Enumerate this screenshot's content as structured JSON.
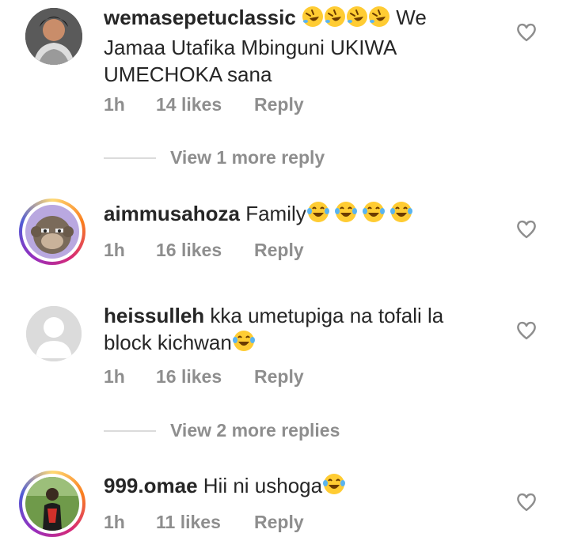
{
  "comments": [
    {
      "username": "wemasepetuclassic",
      "text_after_emoji": " We Jamaa Utafika Mbinguni UKIWA UMECHOKA sana",
      "emoji_desc": "rolling-on-floor-laughing",
      "time": "1h",
      "likes": "14 likes",
      "reply": "Reply"
    },
    {
      "username": "aimmusahoza",
      "text": "Family",
      "emoji_desc": "tears-of-joy",
      "time": "1h",
      "likes": "16 likes",
      "reply": "Reply"
    },
    {
      "username": "heissulleh",
      "text": "kka umetupiga na tofali la block kichwan",
      "emoji_desc": "tears-of-joy",
      "time": "1h",
      "likes": "16 likes",
      "reply": "Reply"
    },
    {
      "username": "999.omae",
      "text": "Hii ni ushoga",
      "emoji_desc": "tears-of-joy",
      "time": "1h",
      "likes": "11 likes",
      "reply": "Reply"
    }
  ],
  "view_more": [
    "View 1 more reply",
    "View 2 more replies"
  ],
  "colors": {
    "text": "#262626",
    "muted": "#8e8e8e",
    "divider": "#dbdbdb"
  }
}
